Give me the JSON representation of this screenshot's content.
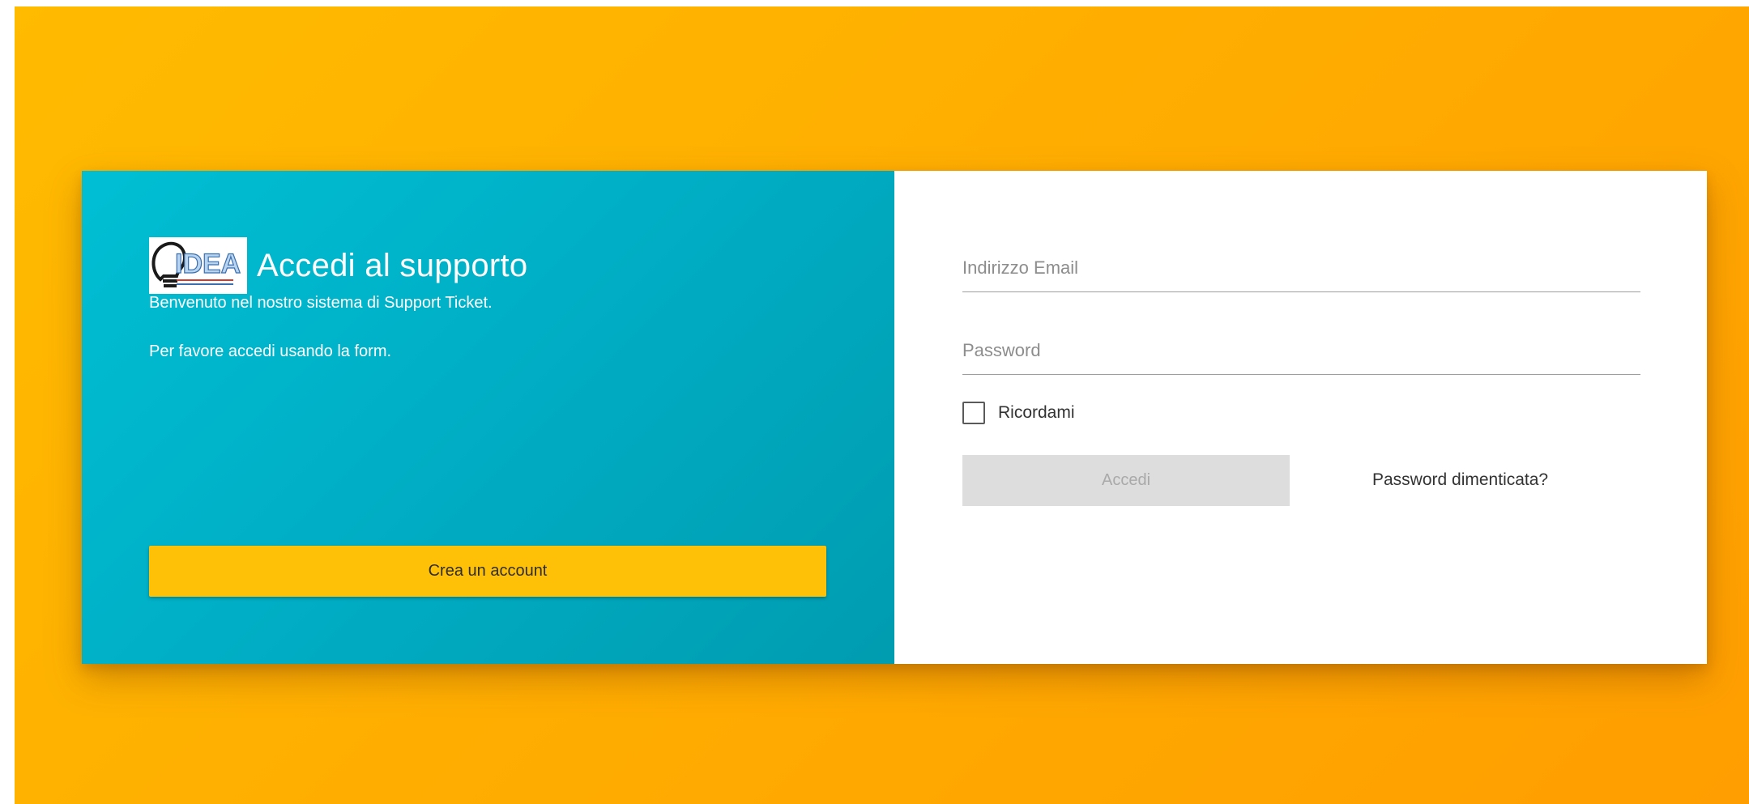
{
  "brand": {
    "title": "Accedi al supporto",
    "logo_text": "IDEA"
  },
  "intro": {
    "welcome": "Benvenuto nel nostro sistema di Support Ticket.",
    "instruction": "Per favore accedi usando la form."
  },
  "left_actions": {
    "create_account_label": "Crea un account"
  },
  "form": {
    "email_placeholder": "Indirizzo Email",
    "email_value": "",
    "password_placeholder": "Password",
    "password_value": "",
    "remember_label": "Ricordami",
    "remember_checked": false,
    "login_label": "Accedi",
    "forgot_label": "Password dimenticata?"
  },
  "colors": {
    "background": "#ffae00",
    "left_panel": "#00adc4",
    "accent_button": "#ffc107",
    "disabled_button": "#dddddd"
  }
}
